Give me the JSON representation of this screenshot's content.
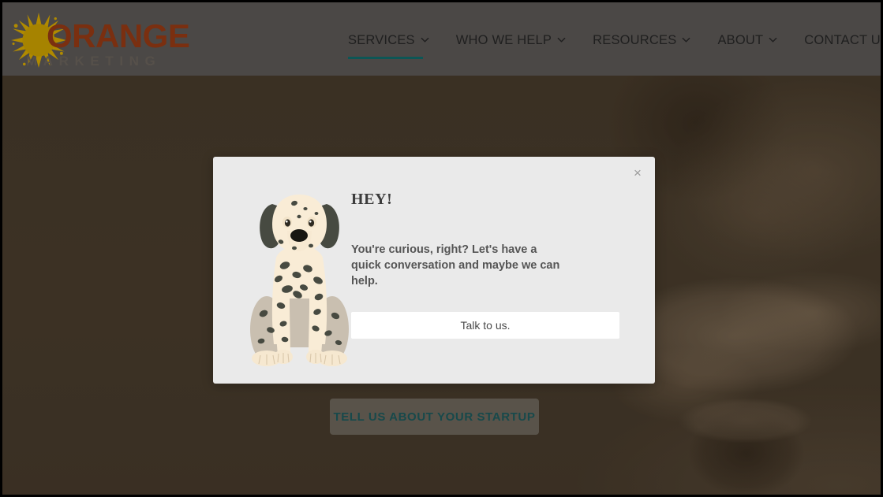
{
  "site": {
    "logo": {
      "icon": "sun-icon",
      "word": "ORANGE",
      "subword": "MARKETING",
      "word_color": "#7a2f10",
      "sub_color": "#56504a",
      "sun_color": "#b08a00"
    }
  },
  "header": {
    "background": "#4b4846",
    "nav": [
      {
        "label": "SERVICES",
        "has_caret": true,
        "active": true
      },
      {
        "label": "WHO WE HELP",
        "has_caret": true,
        "active": false
      },
      {
        "label": "RESOURCES",
        "has_caret": true,
        "active": false
      },
      {
        "label": "ABOUT",
        "has_caret": true,
        "active": false
      },
      {
        "label": "CONTACT US",
        "has_caret": false,
        "active": false
      }
    ],
    "search_icon": "search-icon",
    "active_underline_color": "#0d5655"
  },
  "hero": {
    "overlay_color": "#3a3026",
    "cta": {
      "label": "TELL US ABOUT YOUR STARTUP",
      "text_color": "#17494b"
    }
  },
  "modal": {
    "background": "#eaeaea",
    "close_label": "×",
    "illustration": "dalmatian-dog-illustration",
    "title": "HEY!",
    "body_text": "You're curious, right? Let's have a quick conversation and maybe we can help.",
    "button_label": "Talk to us.",
    "button_background": "#ffffff"
  }
}
